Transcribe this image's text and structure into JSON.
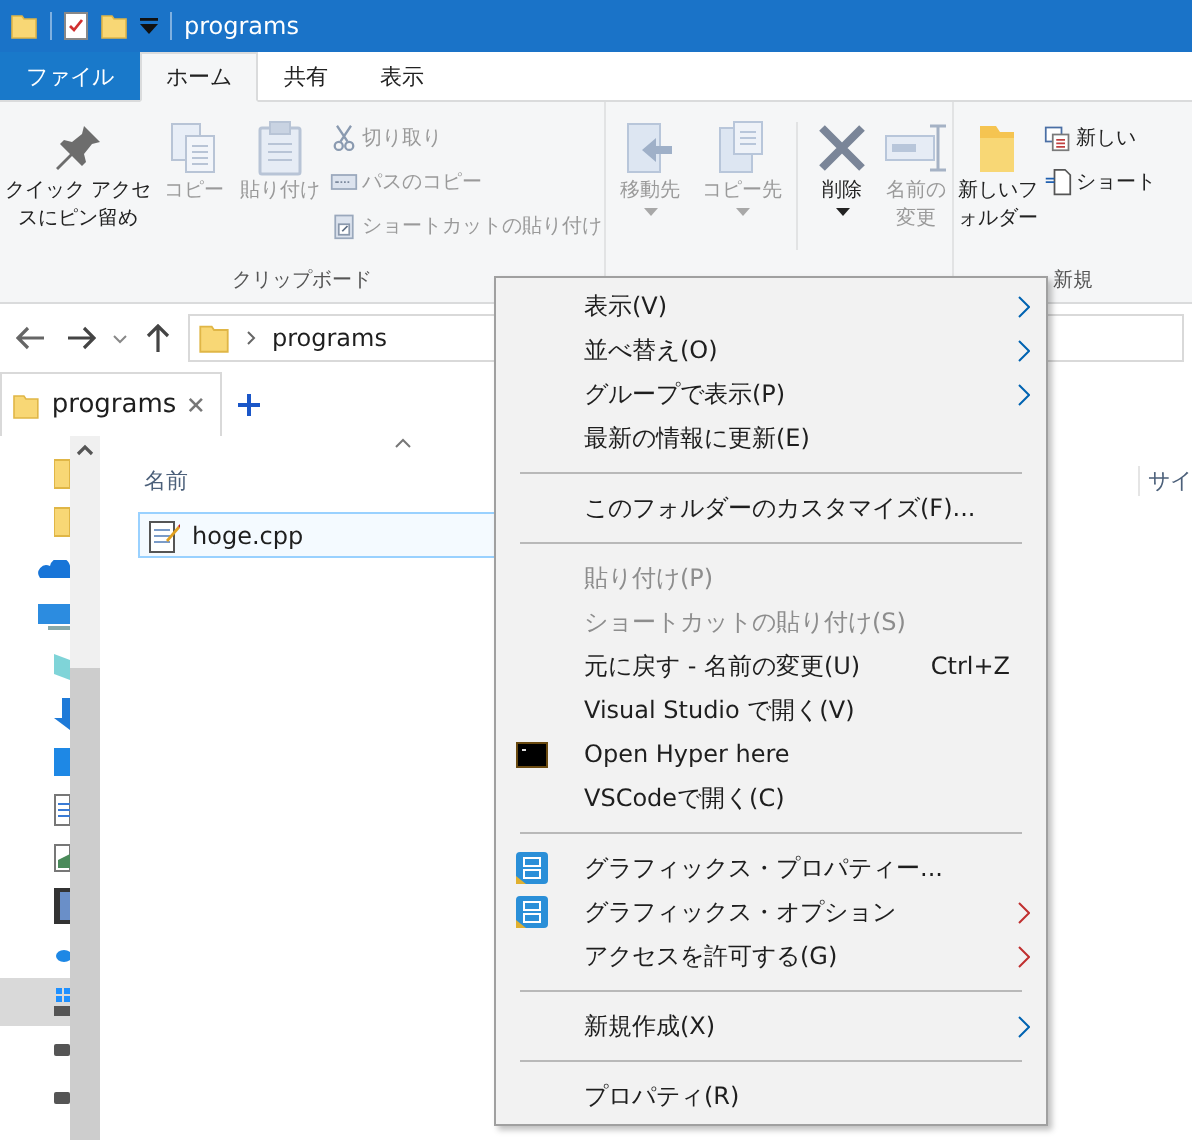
{
  "window": {
    "title": "programs"
  },
  "ribbon_tabs": [
    {
      "label": "ファイル",
      "kind": "file",
      "selected": false
    },
    {
      "label": "ホーム",
      "kind": "tab",
      "selected": true
    },
    {
      "label": "共有",
      "kind": "tab",
      "selected": false
    },
    {
      "label": "表示",
      "kind": "tab",
      "selected": false
    }
  ],
  "ribbon_groups": [
    {
      "label": "クリップボード",
      "items": [
        {
          "kind": "large",
          "label": "クイック アクセスにピン留め",
          "disabled": false
        },
        {
          "kind": "large",
          "label": "コピー",
          "disabled": true
        },
        {
          "kind": "large",
          "label": "貼り付け",
          "disabled": true
        },
        {
          "kind": "stack",
          "buttons": [
            {
              "label": "切り取り",
              "disabled": true
            },
            {
              "label": "パスのコピー",
              "disabled": true
            },
            {
              "label": "ショートカットの貼り付け",
              "disabled": true
            }
          ]
        }
      ]
    },
    {
      "items": [
        {
          "kind": "large",
          "label": "移動先",
          "disabled": true,
          "dropdown": true
        },
        {
          "kind": "large",
          "label": "コピー先",
          "disabled": true,
          "dropdown": true
        },
        {
          "kind": "divider"
        },
        {
          "kind": "large",
          "label": "削除",
          "disabled": false,
          "dropdown": true
        },
        {
          "kind": "large",
          "label": "名前の変更",
          "disabled": true
        }
      ]
    },
    {
      "label": "新規",
      "items": [
        {
          "kind": "large",
          "label": "新しいフォルダー",
          "disabled": false
        },
        {
          "kind": "stack",
          "buttons": [
            {
              "label": "新しい",
              "disabled": false
            },
            {
              "label": "ショート",
              "disabled": false
            }
          ]
        }
      ]
    }
  ],
  "address": {
    "path": [
      "programs"
    ]
  },
  "tabs": [
    {
      "label": "programs",
      "selected": true
    }
  ],
  "sidebar": {
    "items": [
      {
        "kind": "folder",
        "selected": false
      },
      {
        "kind": "folder",
        "selected": false
      },
      {
        "kind": "cloud",
        "selected": false
      },
      {
        "kind": "pc",
        "selected": false
      },
      {
        "kind": "cube",
        "selected": false
      },
      {
        "kind": "download",
        "selected": false
      },
      {
        "kind": "desktop",
        "selected": false
      },
      {
        "kind": "document",
        "selected": false
      },
      {
        "kind": "image",
        "selected": false
      },
      {
        "kind": "video",
        "selected": false
      },
      {
        "kind": "music",
        "selected": false
      },
      {
        "kind": "system-drive",
        "selected": true
      },
      {
        "kind": "drive",
        "selected": false
      },
      {
        "kind": "drive",
        "selected": false
      }
    ]
  },
  "table": {
    "columns": [
      {
        "label": "名前",
        "sorted": true
      },
      {
        "label": "サイ"
      }
    ],
    "rows": [
      {
        "name": "hoge.cpp",
        "selected": true
      }
    ]
  },
  "context_menu": [
    {
      "kind": "item",
      "label": "表示(V)",
      "submenu": true,
      "color": "#0063b1"
    },
    {
      "kind": "item",
      "label": "並べ替え(O)",
      "submenu": true,
      "color": "#0063b1"
    },
    {
      "kind": "item",
      "label": "グループで表示(P)",
      "submenu": true,
      "color": "#0063b1"
    },
    {
      "kind": "item",
      "label": "最新の情報に更新(E)"
    },
    {
      "kind": "separator"
    },
    {
      "kind": "item",
      "label": "このフォルダーのカスタマイズ(F)..."
    },
    {
      "kind": "separator"
    },
    {
      "kind": "item",
      "label": "貼り付け(P)",
      "disabled": true
    },
    {
      "kind": "item",
      "label": "ショートカットの貼り付け(S)",
      "disabled": true
    },
    {
      "kind": "item",
      "label": "元に戻す - 名前の変更(U)",
      "shortcut": "Ctrl+Z"
    },
    {
      "kind": "item",
      "label": "Visual Studio で開く(V)"
    },
    {
      "kind": "terminal",
      "label": "Open Hyper here"
    },
    {
      "kind": "item",
      "label": "VSCodeで開く(C)"
    },
    {
      "kind": "separator"
    },
    {
      "kind": "graphics",
      "label": "グラフィックス・プロパティー..."
    },
    {
      "kind": "graphics",
      "label": "グラフィックス・オプション",
      "submenu": true,
      "color": "#c03030"
    },
    {
      "kind": "item",
      "label": "アクセスを許可する(G)",
      "submenu": true,
      "color": "#c03030"
    },
    {
      "kind": "separator"
    },
    {
      "kind": "item",
      "label": "新規作成(X)",
      "submenu": true,
      "color": "#0063b1"
    },
    {
      "kind": "separator"
    },
    {
      "kind": "item",
      "label": "プロパティ(R)"
    }
  ]
}
